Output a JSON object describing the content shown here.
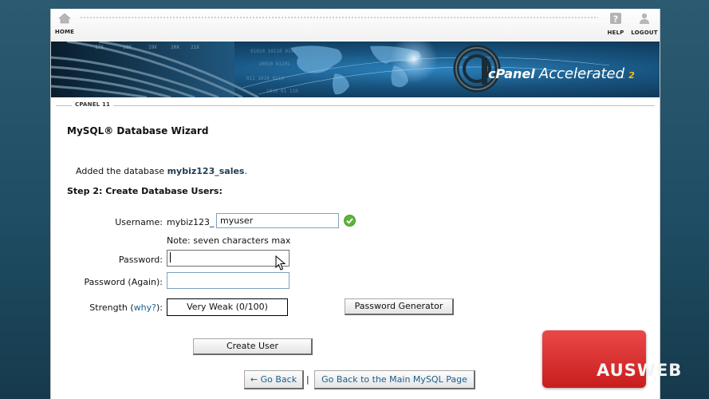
{
  "nav": {
    "home_label": "HOME",
    "help_label": "HELP",
    "logout_label": "LOGOUT"
  },
  "banner": {
    "brand": "cPanel",
    "product": "Accelerated",
    "version": "2"
  },
  "breadcrumb": {
    "label": "CPANEL 11"
  },
  "page": {
    "title": "MySQL® Database Wizard",
    "added_prefix": "Added the database",
    "added_db": "mybiz123_sales",
    "added_suffix": ".",
    "step_title": "Step 2: Create Database Users:"
  },
  "form": {
    "username_label": "Username:",
    "username_prefix": "mybiz123_",
    "username_value": "myuser",
    "username_note": "Note: seven characters max",
    "password_label": "Password:",
    "password_value": "",
    "password_again_label": "Password (Again):",
    "password_again_value": "",
    "strength_prefix": "Strength (",
    "strength_link": "why?",
    "strength_suffix": "):",
    "strength_value": "Very Weak (0/100)",
    "generator_label": "Password Generator",
    "create_label": "Create User"
  },
  "footer": {
    "back_label": "← Go Back",
    "separator": "|",
    "main_label": "Go Back to the Main MySQL Page"
  },
  "watermark": {
    "text": "AUSWEB"
  },
  "colors": {
    "accent_link": "#1b5e8c",
    "valid_check": "#5fb33c",
    "watermark_red": "#d62a2a"
  }
}
